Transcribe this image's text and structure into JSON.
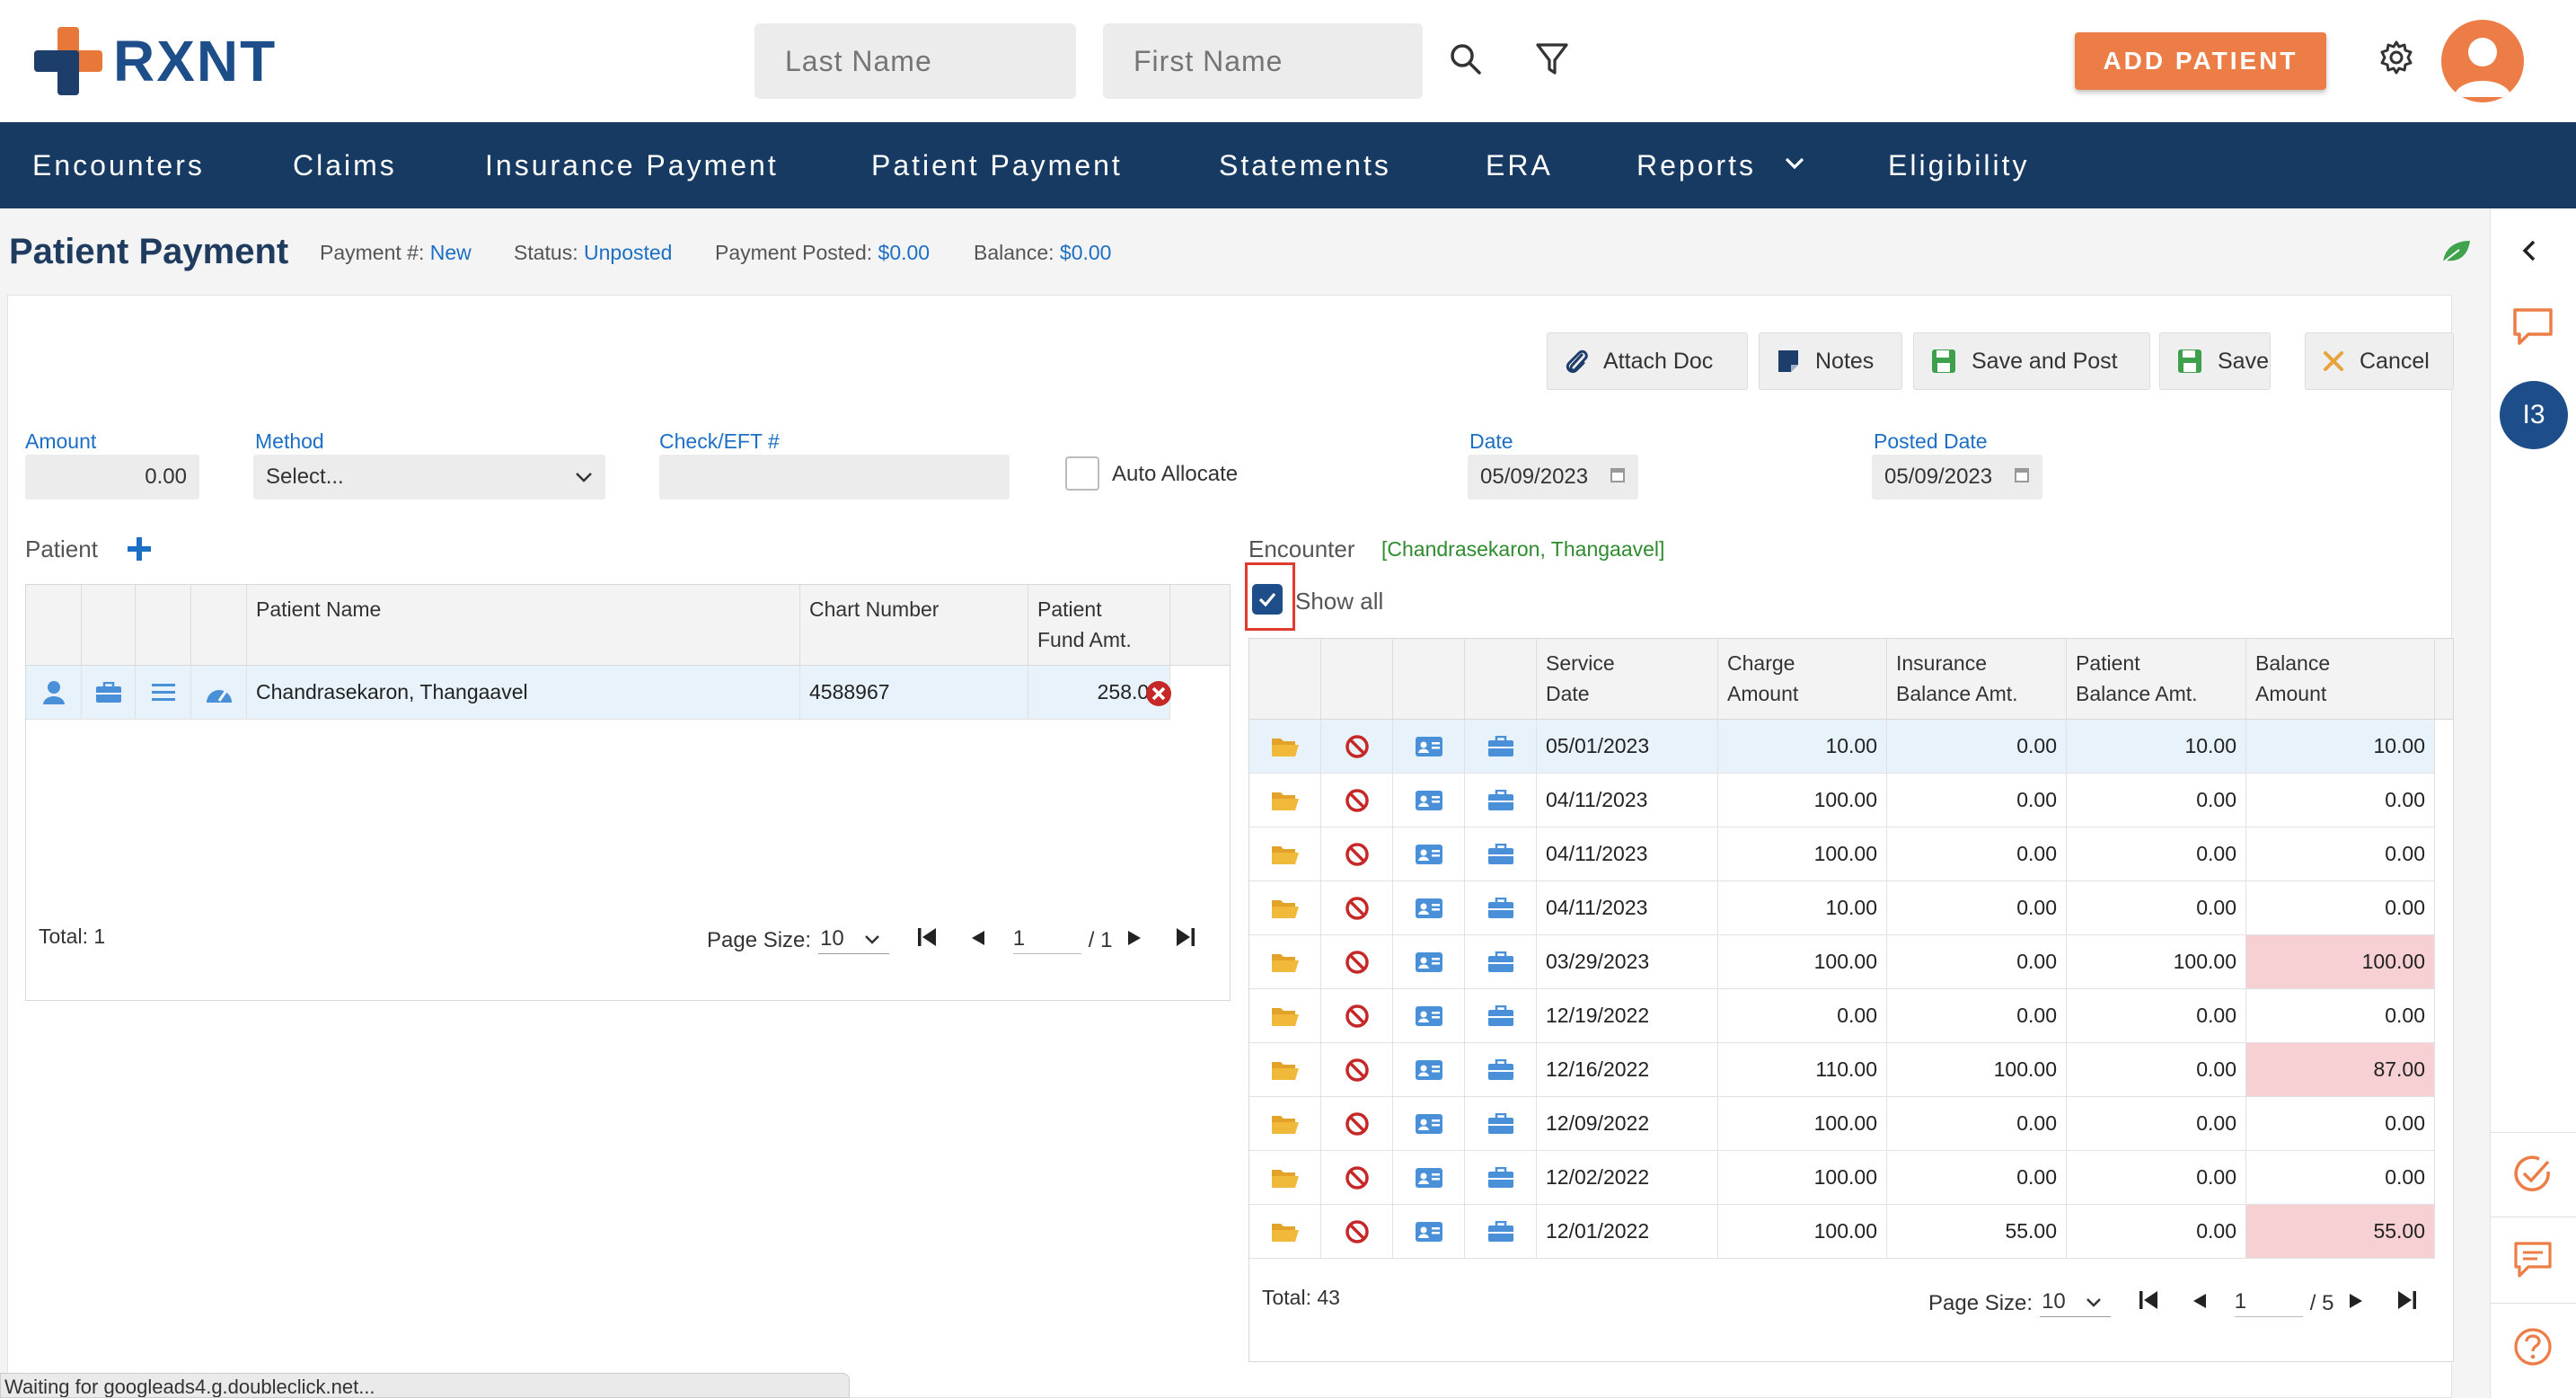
{
  "header": {
    "logo_text": "RXNT",
    "last_name_placeholder": "Last Name",
    "first_name_placeholder": "First Name",
    "add_patient_label": "ADD PATIENT"
  },
  "nav": {
    "items": [
      {
        "label": "Encounters"
      },
      {
        "label": "Claims"
      },
      {
        "label": "Insurance Payment"
      },
      {
        "label": "Patient Payment"
      },
      {
        "label": "Statements"
      },
      {
        "label": "ERA"
      },
      {
        "label": "Reports"
      },
      {
        "label": "Eligibility"
      }
    ]
  },
  "page": {
    "title": "Patient Payment",
    "payment_no_label": "Payment #:",
    "payment_no_value": "New",
    "status_label": "Status:",
    "status_value": "Unposted",
    "posted_label": "Payment Posted:",
    "posted_value": "$0.00",
    "balance_label": "Balance:",
    "balance_value": "$0.00"
  },
  "toolbar": {
    "attach_doc": "Attach Doc",
    "notes": "Notes",
    "save_and_post": "Save and Post",
    "save": "Save",
    "cancel": "Cancel"
  },
  "form": {
    "amount_label": "Amount",
    "amount_value": "0.00",
    "method_label": "Method",
    "method_value": "Select...",
    "check_label": "Check/EFT #",
    "check_value": "",
    "auto_allocate_label": "Auto Allocate",
    "date_label": "Date",
    "date_value": "05/09/2023",
    "posted_date_label": "Posted Date",
    "posted_date_value": "05/09/2023"
  },
  "patient_section": {
    "label": "Patient",
    "headers": {
      "name": "Patient Name",
      "chart": "Chart Number",
      "fund_line1": "Patient",
      "fund_line2": "Fund Amt."
    },
    "rows": [
      {
        "name": "Chandrasekaron, Thangaavel",
        "chart": "4588967",
        "fund": "258.00"
      }
    ],
    "total": "Total: 1",
    "page_size_label": "Page Size:",
    "page_size": "10",
    "page": "1",
    "page_total": "/ 1"
  },
  "encounter_section": {
    "label": "Encounter",
    "selected_patient": "[Chandrasekaron, Thangaavel]",
    "show_all_label": "Show all",
    "headers": {
      "service_date_1": "Service",
      "service_date_2": "Date",
      "charge_1": "Charge",
      "charge_2": "Amount",
      "ins_bal_1": "Insurance",
      "ins_bal_2": "Balance Amt.",
      "pat_bal_1": "Patient",
      "pat_bal_2": "Balance Amt.",
      "bal_1": "Balance",
      "bal_2": "Amount"
    },
    "rows": [
      {
        "date": "05/01/2023",
        "charge": "10.00",
        "ins": "0.00",
        "pat": "10.00",
        "bal": "10.00"
      },
      {
        "date": "04/11/2023",
        "charge": "100.00",
        "ins": "0.00",
        "pat": "0.00",
        "bal": "0.00"
      },
      {
        "date": "04/11/2023",
        "charge": "100.00",
        "ins": "0.00",
        "pat": "0.00",
        "bal": "0.00"
      },
      {
        "date": "04/11/2023",
        "charge": "10.00",
        "ins": "0.00",
        "pat": "0.00",
        "bal": "0.00"
      },
      {
        "date": "03/29/2023",
        "charge": "100.00",
        "ins": "0.00",
        "pat": "100.00",
        "bal": "100.00"
      },
      {
        "date": "12/19/2022",
        "charge": "0.00",
        "ins": "0.00",
        "pat": "0.00",
        "bal": "0.00"
      },
      {
        "date": "12/16/2022",
        "charge": "110.00",
        "ins": "100.00",
        "pat": "0.00",
        "bal": "87.00"
      },
      {
        "date": "12/09/2022",
        "charge": "100.00",
        "ins": "0.00",
        "pat": "0.00",
        "bal": "0.00"
      },
      {
        "date": "12/02/2022",
        "charge": "100.00",
        "ins": "0.00",
        "pat": "0.00",
        "bal": "0.00"
      },
      {
        "date": "12/01/2022",
        "charge": "100.00",
        "ins": "55.00",
        "pat": "0.00",
        "bal": "55.00"
      }
    ],
    "total": "Total: 43",
    "page_size_label": "Page Size:",
    "page_size": "10",
    "page": "1",
    "page_total": "/ 5"
  },
  "right_rail": {
    "badge": "I3"
  },
  "status_bar": "Waiting for googleads4.g.doubleclick.net...",
  "colors": {
    "brand_orange": "#ec7d47",
    "nav_blue": "#173a62",
    "link_blue": "#1c6fc4",
    "highlight_pink": "#f6d0d2"
  }
}
